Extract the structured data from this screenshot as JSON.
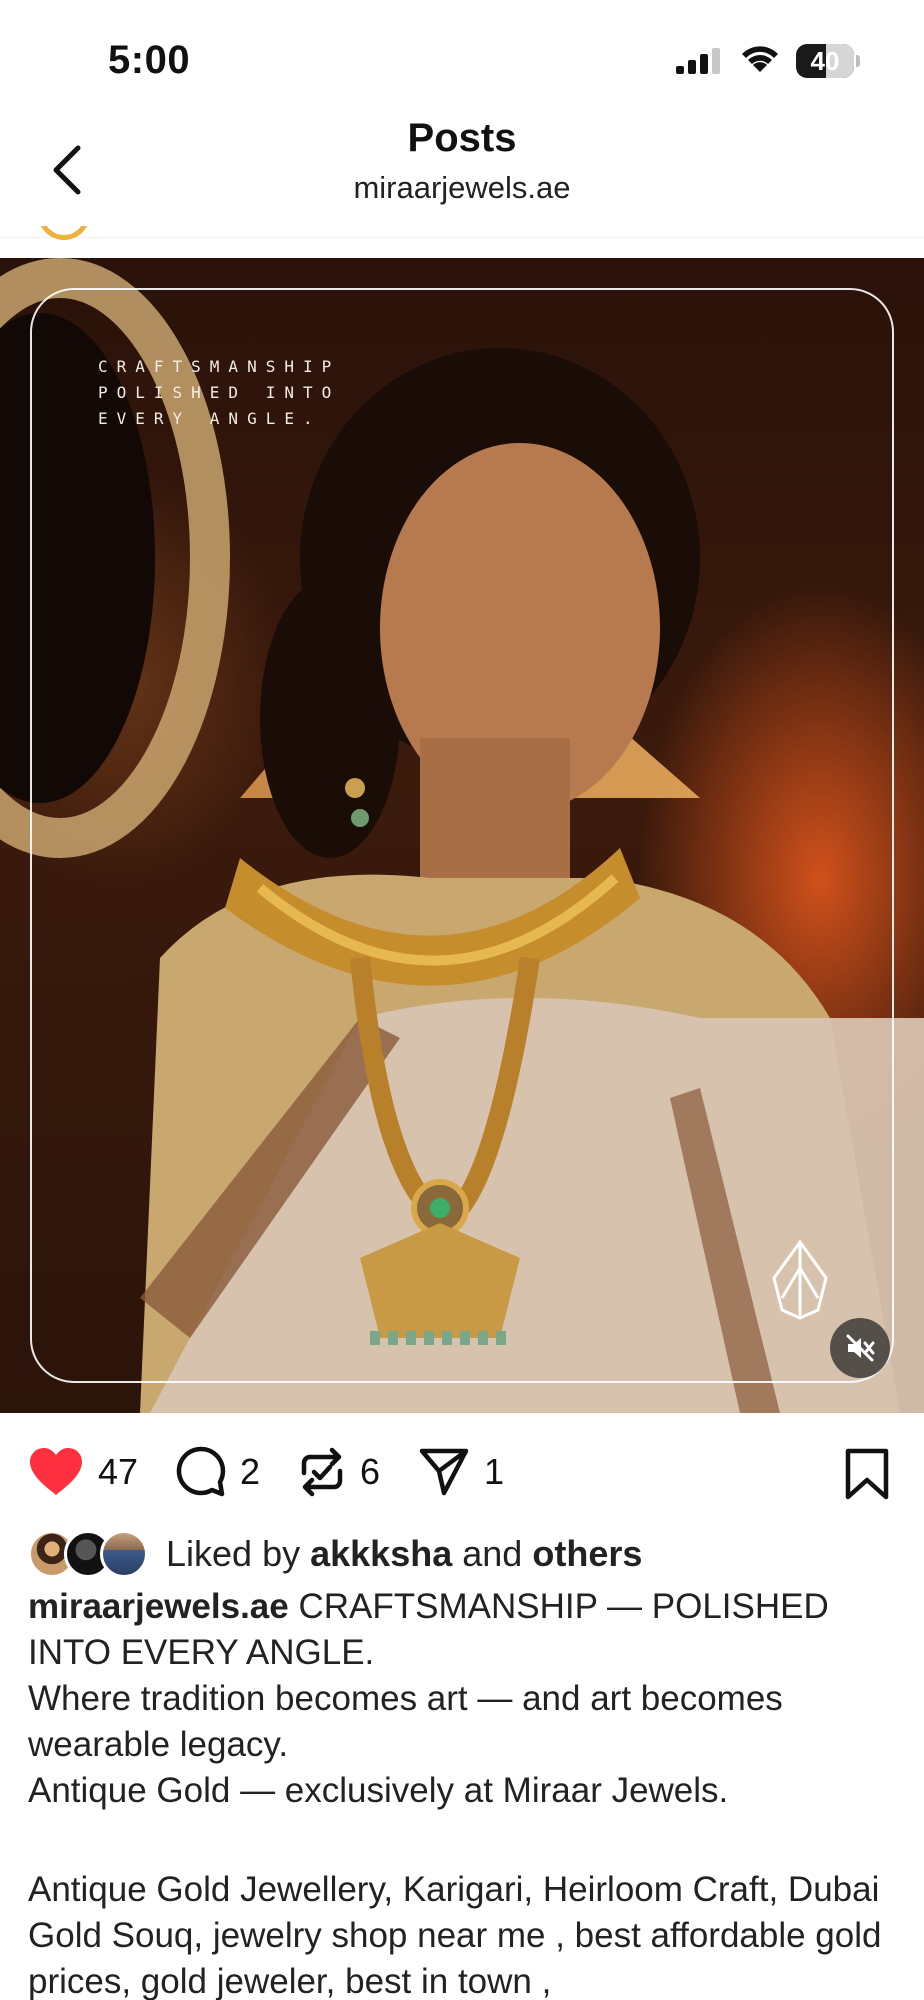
{
  "status_bar": {
    "time": "5:00",
    "battery": "40"
  },
  "header": {
    "title": "Posts",
    "subtitle": "miraarjewels.ae"
  },
  "media": {
    "overlay_text": [
      "CRAFTSMANSHIP",
      "POLISHED INTO",
      "EVERY ANGLE."
    ],
    "muted": true
  },
  "actions": {
    "likes": "47",
    "comments": "2",
    "reposts": "6",
    "shares": "1",
    "liked": true,
    "accent_color": "#ff3040"
  },
  "likes_summary": {
    "prefix": "Liked by",
    "user": "akkksha",
    "joiner": "and",
    "others": "others"
  },
  "caption": {
    "username": "miraarjewels.ae",
    "lines": [
      " CRAFTSMANSHIP — POLISHED INTO EVERY ANGLE.",
      "Where tradition becomes art — and art becomes wearable legacy.",
      "Antique Gold — exclusively at Miraar Jewels.",
      "Antique Gold Jewellery, Karigari, Heirloom Craft, Dubai Gold Souq, jewelry shop near me , best affordable gold prices, gold jeweler, best in town ,"
    ]
  }
}
